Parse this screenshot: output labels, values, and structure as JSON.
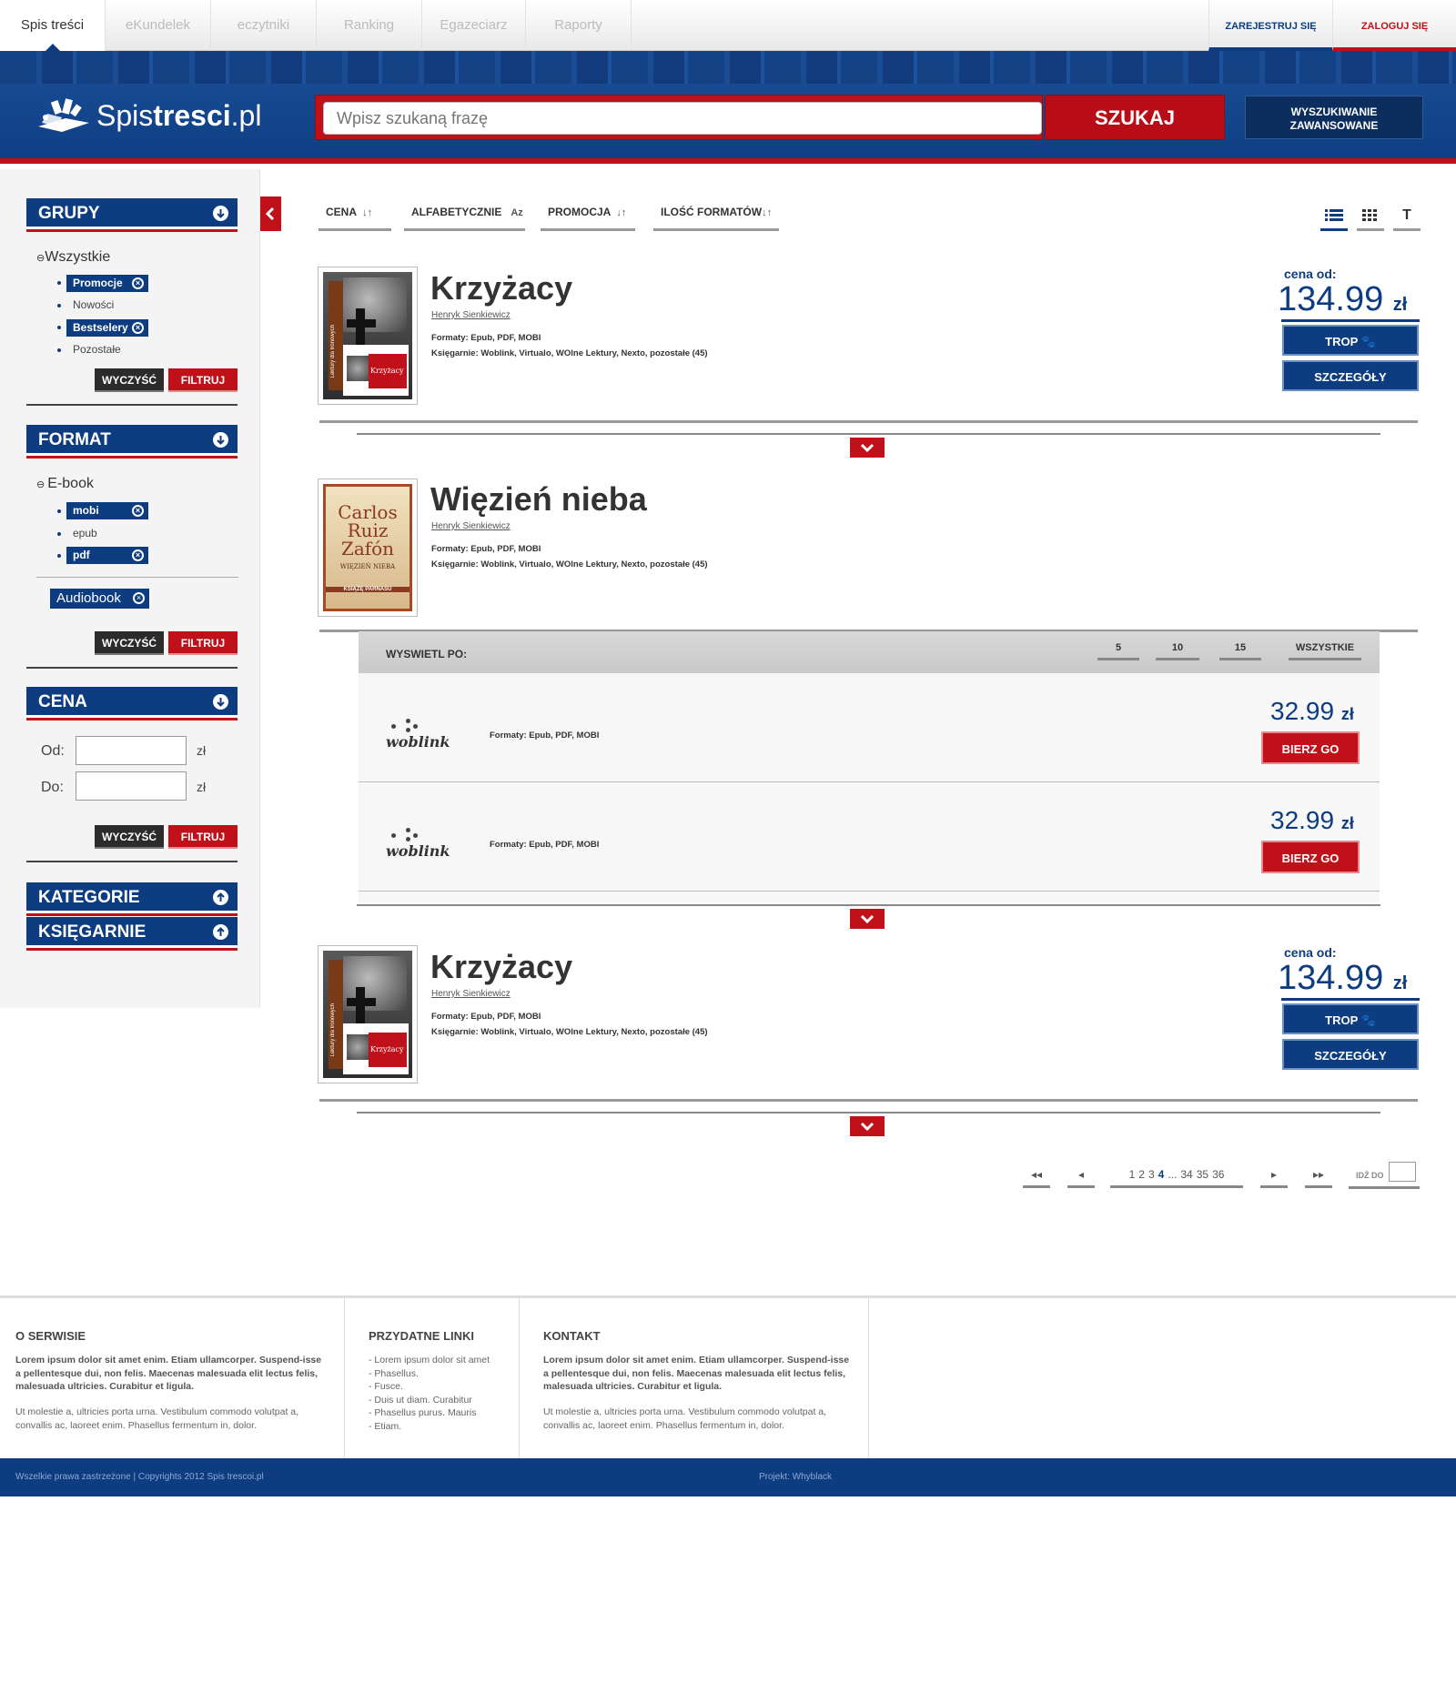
{
  "top_nav": {
    "tabs": [
      {
        "label": "Spis treści",
        "active": true
      },
      {
        "label": "eKundelek"
      },
      {
        "label": "eczytniki"
      },
      {
        "label": "Ranking"
      },
      {
        "label": "Egazeciarz"
      },
      {
        "label": "Raporty"
      }
    ],
    "register": "ZAREJESTRUJ SIĘ",
    "login": "ZALOGUJ SIĘ"
  },
  "header": {
    "logo_light": "Spis",
    "logo_bold": "tresci",
    "logo_tld": ".pl",
    "search_placeholder": "Wpisz szukaną frazę",
    "search_button": "SZUKAJ",
    "advanced_line1": "WYSZUKIWANIE",
    "advanced_line2": "ZAWANSOWANE"
  },
  "sidebar": {
    "groups": {
      "title": "GRUPY",
      "all": "Wszystkie",
      "items": [
        {
          "label": "Promocje",
          "selected": true
        },
        {
          "label": "Nowości",
          "selected": false
        },
        {
          "label": "Bestselery",
          "selected": true
        },
        {
          "label": "Pozostałe",
          "selected": false
        }
      ]
    },
    "format": {
      "title": "FORMAT",
      "ebook": "E-book",
      "items": [
        {
          "label": "mobi",
          "selected": true
        },
        {
          "label": "epub",
          "selected": false
        },
        {
          "label": "pdf",
          "selected": true
        }
      ],
      "audiobook": "Audiobook"
    },
    "price": {
      "title": "CENA",
      "from": "Od:",
      "to": "Do:",
      "currency": "zł"
    },
    "categories": "KATEGORIE",
    "bookstores": "KSIĘGARNIE",
    "clear": "WYCZYŚĆ",
    "filter": "FILTRUJ"
  },
  "sort": {
    "price": "CENA",
    "alpha": "ALFABETYCZNIE",
    "alpha_icon": "Az",
    "promo": "PROMOCJA",
    "formats": "ILOŚĆ FORMATÓW",
    "view_text": "T"
  },
  "books": [
    {
      "title": "Krzyżacy",
      "author": "Henryk Sienkiewicz",
      "formats": "Formaty:  Epub, PDF, MOBI",
      "stores": "Księgarnie:  Woblink, Virtualo, WOlne Lektury, Nexto, pozostałe (45)",
      "price_from": "cena od:",
      "price": "134.99",
      "currency": "zł",
      "trop": "TROP",
      "details": "SZCZEGÓŁY",
      "cover_series": "Lektury dla Ironowych",
      "cover_title": "Krzyżacy"
    },
    {
      "title": "Więzień nieba",
      "author": "Henryk Sienkiewicz",
      "formats": "Formaty:  Epub, PDF, MOBI",
      "stores": "Księgarnie:  Woblink, Virtualo, WOlne Lektury, Nexto, pozostałe (45)",
      "cover_author1": "Carlos",
      "cover_author2": "Ruiz",
      "cover_author3": "Zafón",
      "cover_title": "WIĘZIEŃ NIEBA",
      "cover_sub": "KSIĄŻĘ PARNASU"
    },
    {
      "title": "Krzyżacy",
      "author": "Henryk Sienkiewicz",
      "formats": "Formaty:  Epub, PDF, MOBI",
      "stores": "Księgarnie:  Woblink, Virtualo, WOlne Lektury, Nexto, pozostałe (45)",
      "price_from": "cena od:",
      "price": "134.99",
      "currency": "zł",
      "trop": "TROP",
      "details": "SZCZEGÓŁY",
      "cover_series": "Lektury dla Ironowych",
      "cover_title": "Krzyżacy"
    }
  ],
  "store_panel": {
    "per_page_label": "WYSWIETL PO:",
    "per_page": [
      "5",
      "10",
      "15",
      "WSZYSTKIE"
    ],
    "offers": [
      {
        "store": "woblink",
        "formats": "Formaty:  Epub, PDF, MOBI",
        "price": "32.99",
        "currency": "zł",
        "button": "BIERZ GO"
      },
      {
        "store": "woblink",
        "formats": "Formaty:  Epub, PDF, MOBI",
        "price": "32.99",
        "currency": "zł",
        "button": "BIERZ GO"
      }
    ]
  },
  "pagination": {
    "first": "◂◂",
    "prev": "◂",
    "pages": [
      "1",
      "2",
      "3",
      "4",
      "...",
      "34",
      "35",
      "36"
    ],
    "current": "4",
    "next": "▸",
    "last": "▸▸",
    "goto_label": "IDŹ DO"
  },
  "footer": {
    "about_title": "O SERWISIE",
    "about_bold": "Lorem ipsum dolor sit amet enim. Etiam ullamcorper. Suspend-isse a pellentesque dui, non felis. Maecenas malesuada elit lectus felis, malesuada ultricies. Curabitur et ligula.",
    "about_text": "Ut molestie a, ultricies porta urna. Vestibulum commodo volutpat a, convallis ac, laoreet enim. Phasellus fermentum in, dolor.",
    "links_title": "PRZYDATNE LINKI",
    "links": [
      "- Lorem ipsum dolor sit amet",
      "- Phasellus.",
      "- Fusce.",
      "- Duis ut diam. Curabitur",
      "- Phasellus purus. Mauris",
      "- Etiam."
    ],
    "contact_title": "KONTAKT",
    "contact_bold": "Lorem ipsum dolor sit amet enim. Etiam ullamcorper. Suspend-isse a pellentesque dui, non felis. Maecenas malesuada elit lectus felis, malesuada ultricies. Curabitur et ligula.",
    "contact_text": "Ut molestie a, ultricies porta urna. Vestibulum commodo volutpat a, convallis ac, laoreet enim. Phasellus fermentum in, dolor.",
    "copyright": "Wszelkie prawa zastrzeżone | Copyrights 2012 Spis trescoi.pl",
    "project": "Projekt: Whyblack"
  },
  "colors": {
    "brand_blue": "#0d3d80",
    "brand_red": "#c0101a"
  }
}
